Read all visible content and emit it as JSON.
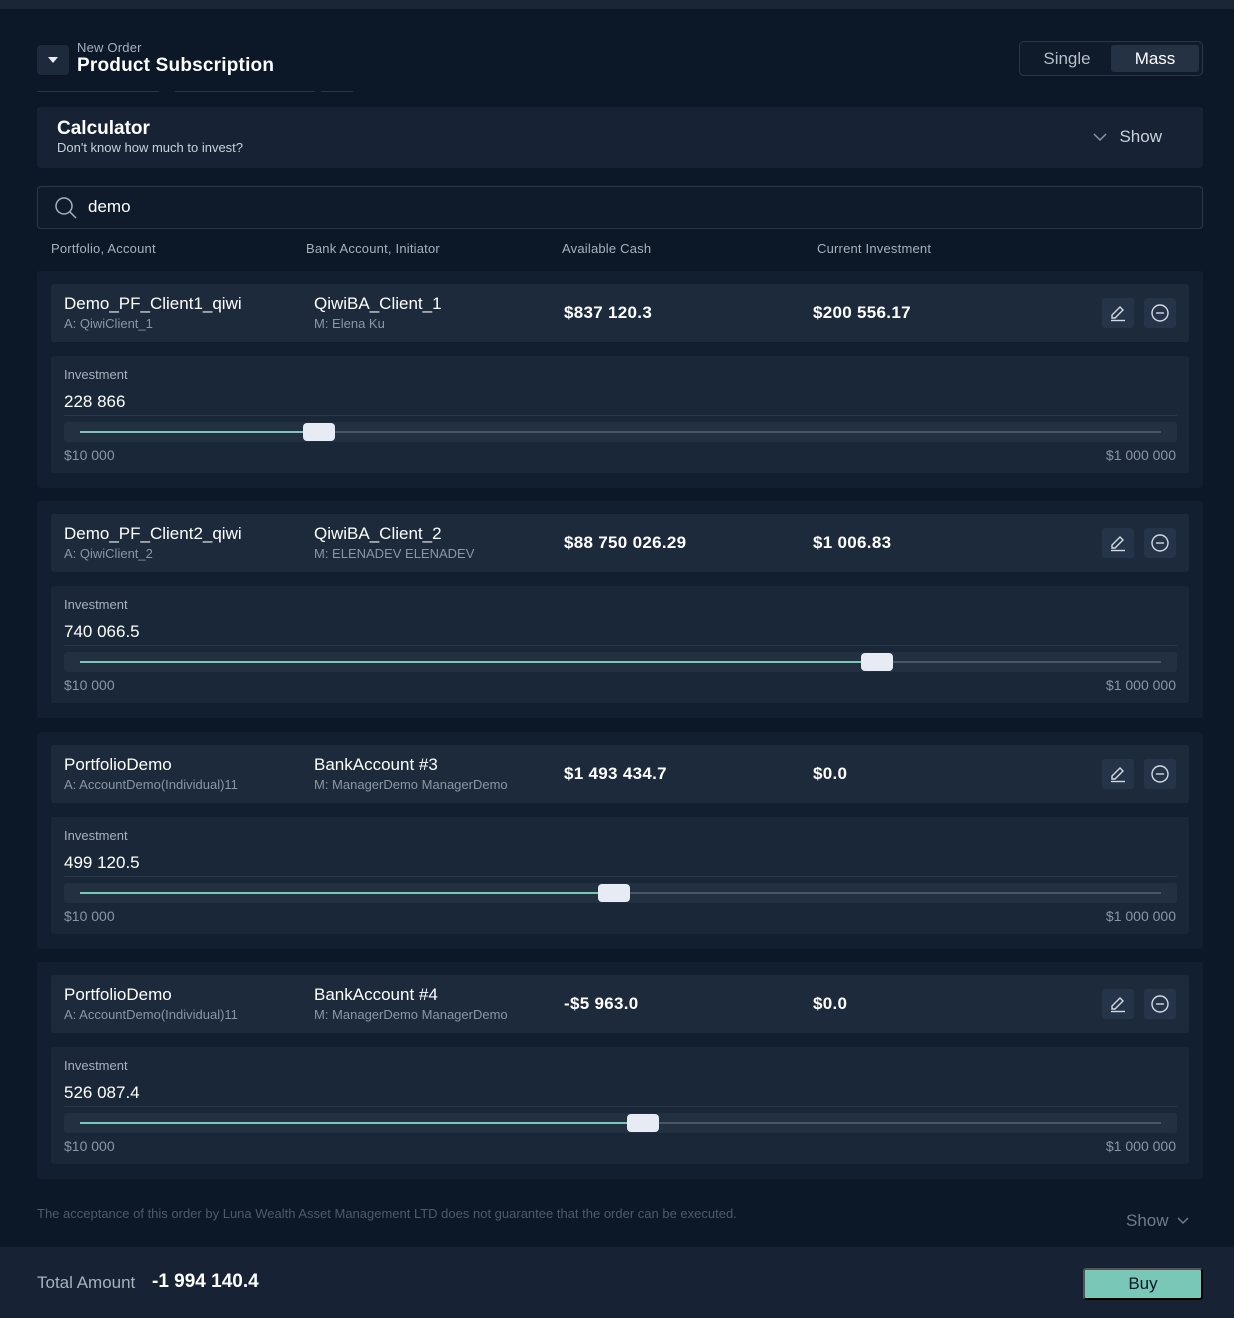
{
  "header": {
    "subtitle": "New Order",
    "title": "Product Subscription",
    "toggle": {
      "single": "Single",
      "mass": "Mass",
      "selected": "Mass"
    }
  },
  "calculator": {
    "title": "Calculator",
    "subtitle": "Don't know how much to invest?",
    "show_label": "Show"
  },
  "search": {
    "value": "demo"
  },
  "columns": {
    "portfolio": "Portfolio, Account",
    "bank": "Bank Account, Initiator",
    "cash": "Available Cash",
    "investment": "Current Investment"
  },
  "items": [
    {
      "portfolio": "Demo_PF_Client1_qiwi",
      "account": "A: QiwiClient_1",
      "bank": "QiwiBA_Client_1",
      "manager": "M: Elena Ku",
      "cash": "$837 120.3",
      "current": "$200 556.17",
      "invest_label": "Investment",
      "invest_value": "228 866",
      "min": "$10 000",
      "max": "$1 000 000",
      "slider_pct": 22.1
    },
    {
      "portfolio": "Demo_PF_Client2_qiwi",
      "account": "A: QiwiClient_2",
      "bank": "QiwiBA_Client_2",
      "manager": "M: ELENADEV ELENADEV",
      "cash": "$88 750 026.29",
      "current": "$1 006.83",
      "invest_label": "Investment",
      "invest_value": "740 066.5",
      "min": "$10 000",
      "max": "$1 000 000",
      "slider_pct": 73.7
    },
    {
      "portfolio": "PortfolioDemo",
      "account": "A: AccountDemo(Individual)11",
      "bank": "BankAccount #3",
      "manager": "M: ManagerDemo ManagerDemo",
      "cash": "$1 493 434.7",
      "current": "$0.0",
      "invest_label": "Investment",
      "invest_value": "499 120.5",
      "min": "$10 000",
      "max": "$1 000 000",
      "slider_pct": 49.4
    },
    {
      "portfolio": "PortfolioDemo",
      "account": "A: AccountDemo(Individual)11",
      "bank": "BankAccount #4",
      "manager": "M: ManagerDemo ManagerDemo",
      "cash": "-$5 963.0",
      "current": "$0.0",
      "invest_label": "Investment",
      "invest_value": "526 087.4",
      "min": "$10 000",
      "max": "$1 000 000",
      "slider_pct": 52.1
    }
  ],
  "footer": {
    "disclaimer": "The acceptance of this order by Luna Wealth Asset Management LTD does not guarantee that the order can be executed.",
    "show_label": "Show",
    "total_label": "Total Amount",
    "total_value": "-1 994 140.4",
    "buy_label": "Buy"
  },
  "colors": {
    "accent": "#79c7b6",
    "background": "#0c1827",
    "card": "#1c2a3b"
  },
  "icons": [
    "chevron-down-icon",
    "search-icon",
    "edit-icon",
    "remove-icon"
  ]
}
